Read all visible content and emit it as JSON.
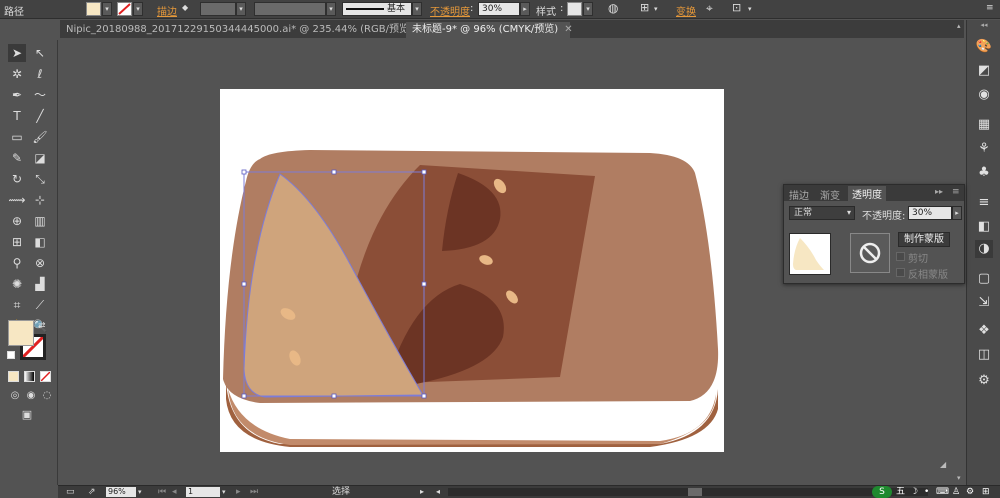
{
  "control_bar": {
    "object_type": "路径",
    "stroke_label": "描边",
    "stroke_style": "基本",
    "opacity_label": "不透明度",
    "opacity_value": "30%",
    "style_label": "样式",
    "transform_label": "变换",
    "fill_color": "#f7e7c3"
  },
  "tabs": [
    {
      "label": "Nipic_20180988_20171229150344445000.ai* @ 235.44% (RGB/预览)"
    },
    {
      "label": "未标题-9* @ 96% (CMYK/预览)"
    }
  ],
  "tools": {
    "fill_color": "#f7e7c3"
  },
  "transparency_panel": {
    "tab_stroke": "描边",
    "tab_gradient": "渐变",
    "tab_transparency": "透明度",
    "blend_mode": "正常",
    "opacity_label": "不透明度:",
    "opacity_value": "30%",
    "make_mask_label": "制作蒙版",
    "clip_label": "剪切",
    "invert_mask_label": "反相蒙版"
  },
  "status_bar": {
    "zoom": "96%",
    "page": "1",
    "tool_status": "选择"
  },
  "artwork": {
    "card_color": "#b07d62",
    "card_dark_color": "#8b4e37",
    "letter_color": "#6c3424",
    "side_color": "#a0613f",
    "highlight_color": "#cfa47c",
    "seed_color": "#e8b886",
    "selection_color": "#7c7cd8"
  }
}
